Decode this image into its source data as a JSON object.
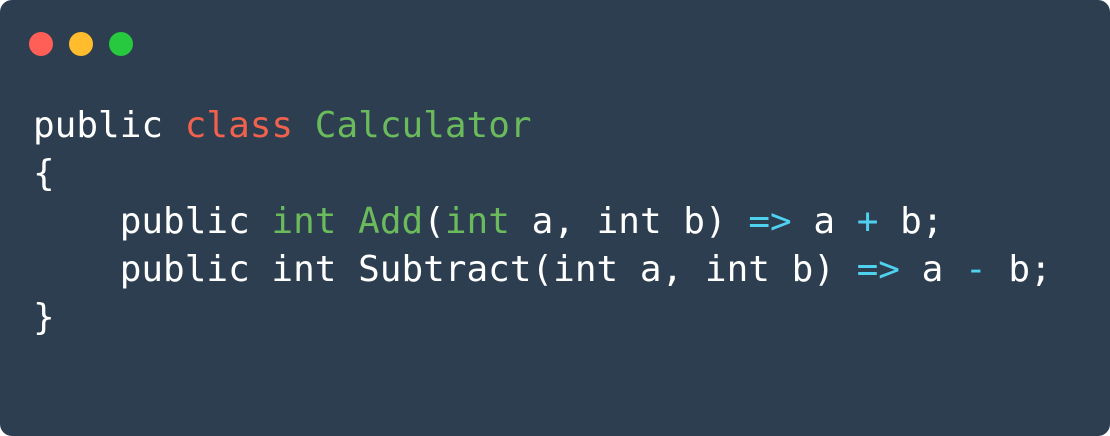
{
  "window": {
    "controls": [
      "close-dot",
      "minimize-dot",
      "zoom-dot"
    ],
    "colors": {
      "background": "#2c3e50",
      "close": "#ff5f56",
      "minimize": "#ffbd2e",
      "zoom": "#27c93f",
      "keyword_red": "#f0624d",
      "keyword_green": "#6bbb5c",
      "operator_cyan": "#4fd2f0",
      "text": "#ffffff"
    }
  },
  "code": {
    "line1": {
      "t1": "public",
      "t2": " ",
      "t3": "class",
      "t4": " ",
      "t5": "Calculator"
    },
    "line2": {
      "t1": "{"
    },
    "line3": {
      "indent": "    ",
      "t1": "public",
      "t2": " ",
      "t3": "int",
      "t4": " ",
      "t5": "Add",
      "t6": "(",
      "t7": "int",
      "t8": " a, int b) ",
      "t9": "=>",
      "t10": " a ",
      "t11": "+",
      "t12": " b;"
    },
    "line4": {
      "indent": "    ",
      "t1": "public int Subtract(int a, int b) ",
      "t2": "=>",
      "t3": " a ",
      "t4": "-",
      "t5": " b;"
    },
    "line5": {
      "t1": "}"
    }
  }
}
